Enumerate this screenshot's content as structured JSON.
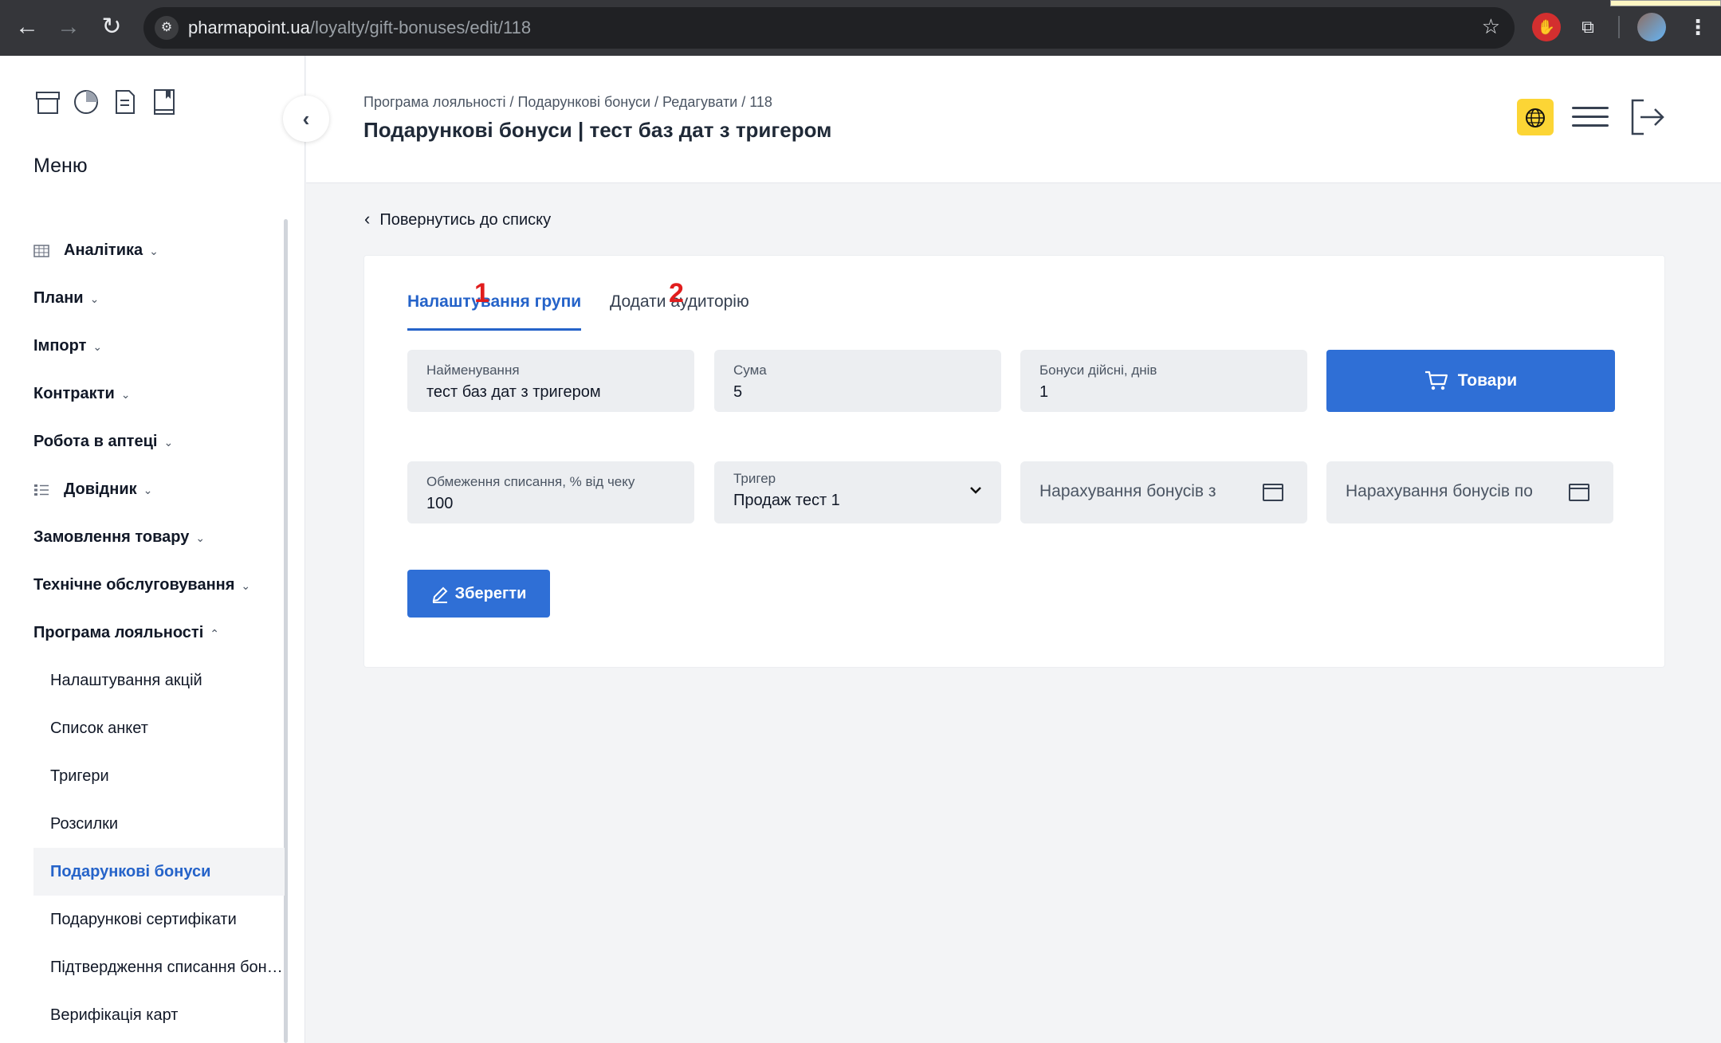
{
  "browser": {
    "url_domain": "pharmapoint.ua",
    "url_path": "/loyalty/gift-bonuses/edit/118",
    "back_icon": "←",
    "forward_icon": "→",
    "reload_icon": "↻",
    "menu_icon": "⋮"
  },
  "sidebar": {
    "menu_title": "Меню",
    "collapse_icon": "‹",
    "items": [
      {
        "label": "Аналітика",
        "icon": "table-icon",
        "expanded": false
      },
      {
        "label": "Плани",
        "expanded": false
      },
      {
        "label": "Імпорт",
        "expanded": false
      },
      {
        "label": "Контракти",
        "expanded": false
      },
      {
        "label": "Робота в аптеці",
        "expanded": false
      },
      {
        "label": "Довідник",
        "icon": "list-icon",
        "expanded": false
      },
      {
        "label": "Замовлення товару",
        "expanded": false
      },
      {
        "label": "Технічне обслуговування",
        "expanded": false
      },
      {
        "label": "Програма лояльності",
        "expanded": true
      }
    ],
    "chevron_down": "⌄",
    "chevron_up": "⌃",
    "sub_items": [
      {
        "label": "Налаштування акцій",
        "active": false
      },
      {
        "label": "Список анкет",
        "active": false
      },
      {
        "label": "Тригери",
        "active": false
      },
      {
        "label": "Розсилки",
        "active": false
      },
      {
        "label": "Подарункові бонуси",
        "active": true
      },
      {
        "label": "Подарункові сертифікати",
        "active": false
      },
      {
        "label": "Підтвердження списання бону...",
        "active": false
      },
      {
        "label": "Верифікація карт",
        "active": false
      }
    ]
  },
  "header": {
    "breadcrumb": "Програма лояльності / Подарункові бонуси / Редагувати / 118",
    "title": "Подарункові бонуси | тест баз дат з тригером"
  },
  "main": {
    "back_link": "Повернутись до списку",
    "tabs": [
      {
        "label": "Налаштування групи",
        "active": true,
        "annotation": "1"
      },
      {
        "label": "Додати аудиторію",
        "active": false,
        "annotation": "2"
      }
    ],
    "fields": {
      "name": {
        "label": "Найменування",
        "value": "тест баз дат з тригером"
      },
      "sum": {
        "label": "Сума",
        "value": "5"
      },
      "valid_days": {
        "label": "Бонуси дійсні, днів",
        "value": "1"
      },
      "limit": {
        "label": "Обмеження списання, % від чеку",
        "value": "100"
      },
      "trigger": {
        "label": "Тригер",
        "value": "Продаж тест 1"
      },
      "accrual_from": {
        "placeholder": "Нарахування бонусів з"
      },
      "accrual_to": {
        "placeholder": "Нарахування бонусів по"
      }
    },
    "goods_button": "Товари",
    "save_button": "Зберегти"
  },
  "colors": {
    "primary": "#2f6fd6",
    "accent_yellow": "#fcd535",
    "annotation_red": "#e11d1d"
  }
}
